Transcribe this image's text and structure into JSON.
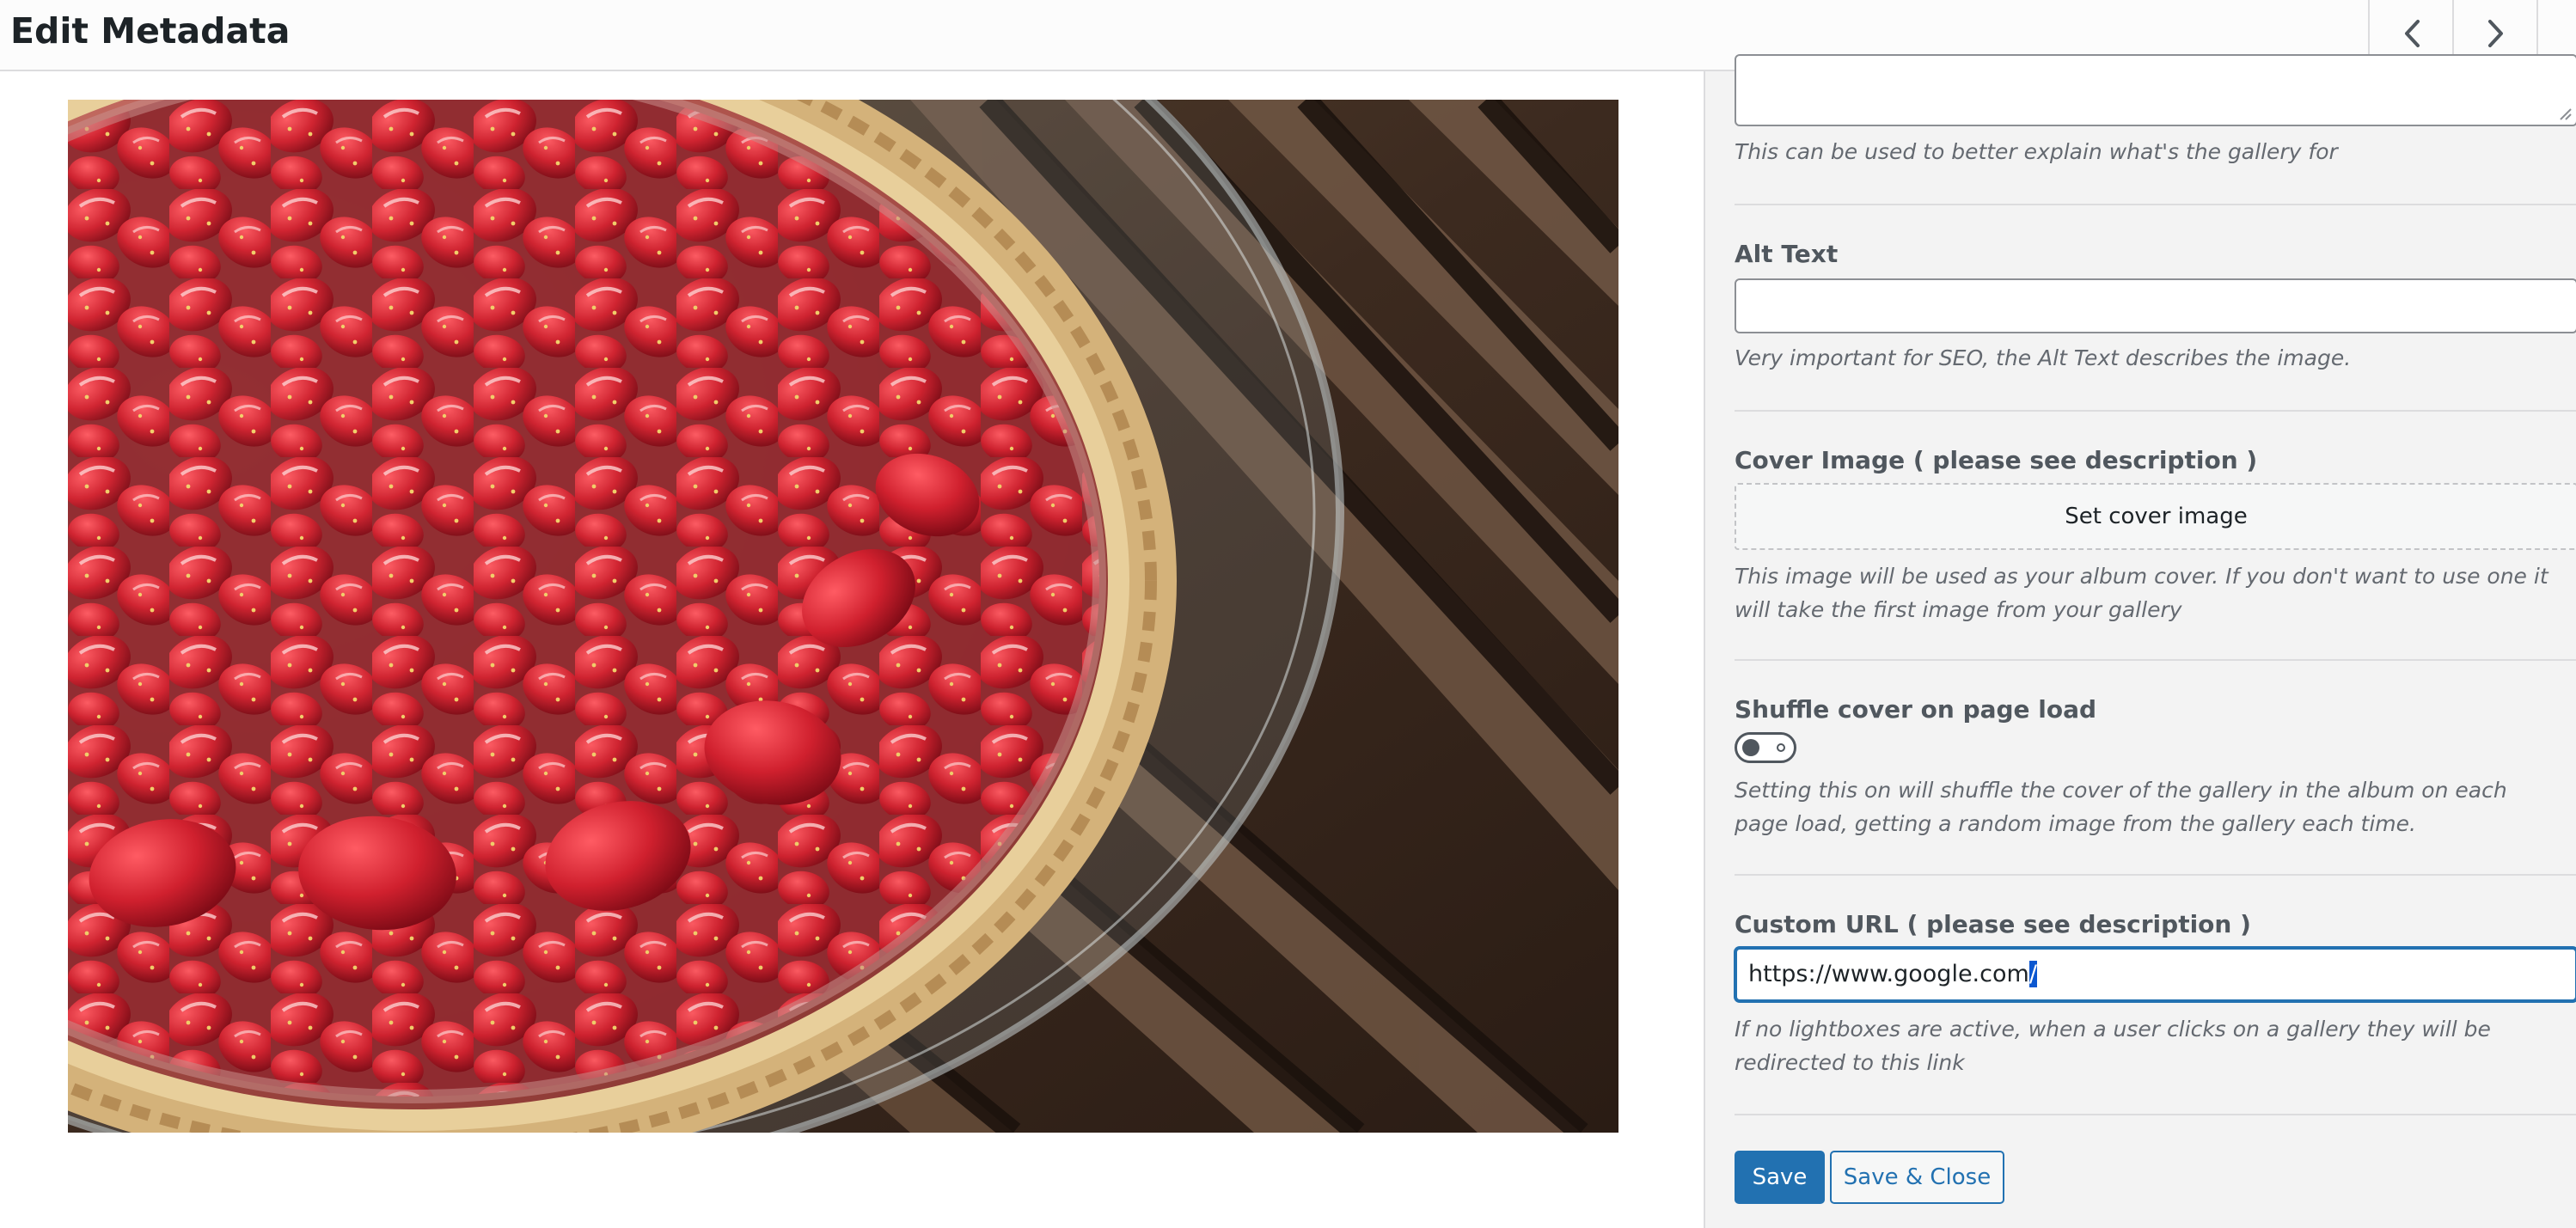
{
  "header": {
    "title": "Edit Metadata",
    "prev_icon": "chevron-left-icon",
    "next_icon": "chevron-right-icon"
  },
  "media": {
    "image_subject": "strawberry tart on glass plate over wooden slats"
  },
  "settings": {
    "caption_help": "This can be used to better explain what's the gallery for",
    "alt_text": {
      "label": "Alt Text",
      "value": "",
      "help": "Very important for SEO, the Alt Text describes the image."
    },
    "cover_image": {
      "label": "Cover Image ( please see description )",
      "button_label": "Set cover image",
      "help": "This image will be used as your album cover. If you don't want to use one it will take the first image from your gallery"
    },
    "shuffle_cover": {
      "label": "Shuffle cover on page load",
      "enabled": false,
      "help": "Setting this on will shuffle the cover of the gallery in the album on each page load, getting a random image from the gallery each time."
    },
    "custom_url": {
      "label": "Custom URL ( please see description )",
      "value_main": "https://www.google.com",
      "value_selected": "/",
      "help": "If no lightboxes are active, when a user clicks on a gallery they will be redirected to this link"
    },
    "actions": {
      "save_label": "Save",
      "save_close_label": "Save & Close"
    }
  },
  "colors": {
    "accent": "#2271b1",
    "panel_bg": "#f3f3f3",
    "label_text": "#50575e",
    "help_text": "#646970"
  }
}
